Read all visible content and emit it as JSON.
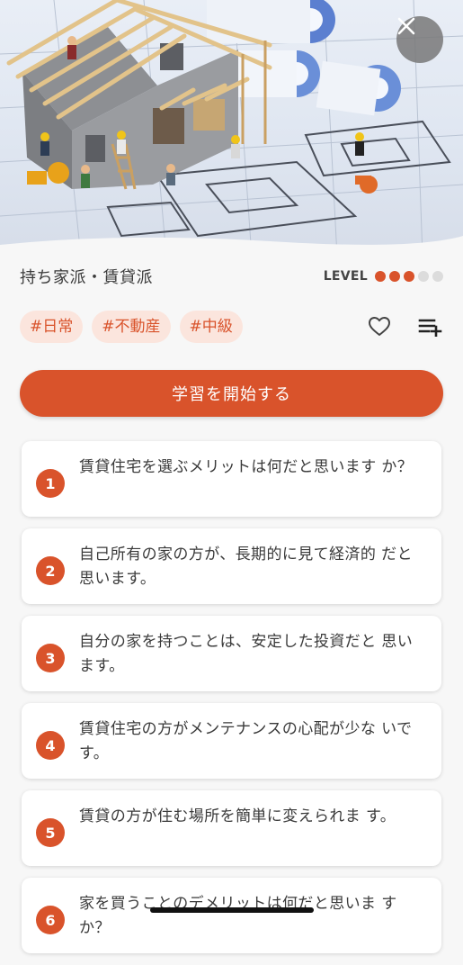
{
  "header": {
    "close_icon": "close-icon"
  },
  "lesson": {
    "title": "持ち家派・賃貸派",
    "level_label": "LEVEL",
    "level": 3,
    "level_max": 5,
    "accent_color": "#d9532b"
  },
  "tags": [
    "#日常",
    "#不動産",
    "#中級"
  ],
  "actions": {
    "favorite_icon": "heart-outline-icon",
    "add_to_list_icon": "playlist-add-icon"
  },
  "start_button": {
    "label": "学習を開始する"
  },
  "questions": [
    {
      "number": "1",
      "text": "賃貸住宅を選ぶメリットは何だと思います か？"
    },
    {
      "number": "2",
      "text": "自己所有の家の方が、長期的に見て経済的 だと思います。"
    },
    {
      "number": "3",
      "text": "自分の家を持つことは、安定した投資だと 思います。"
    },
    {
      "number": "4",
      "text": "賃貸住宅の方がメンテナンスの心配が少な いです。"
    },
    {
      "number": "5",
      "text": "賃貸の方が住む場所を簡単に変えられま す。"
    },
    {
      "number": "6",
      "text": "家を買うことのデメリットは何だと思いま すか？"
    }
  ]
}
